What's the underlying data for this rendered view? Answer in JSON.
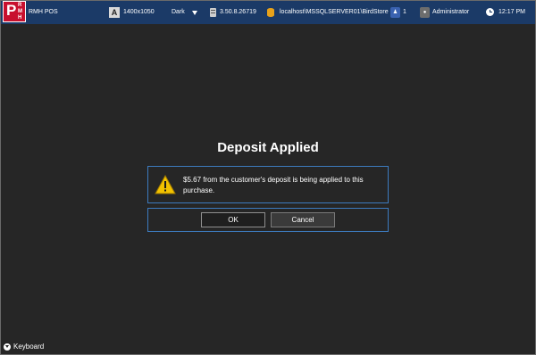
{
  "topbar": {
    "logo": {
      "big_letter": "P",
      "small_letters": [
        "R",
        "M",
        "H"
      ]
    },
    "app_name": "RMH POS",
    "resolution": "1400x1050",
    "resolution_icon_letter": "A",
    "theme": "Dark",
    "version": "3.50.8.26719",
    "database": "localhost\\MSSQLSERVER01\\BirdStore",
    "station": "1",
    "user": "Administrator",
    "time": "12:17 PM"
  },
  "dialog": {
    "title": "Deposit Applied",
    "message": "$5.67 from the customer's deposit is being applied to this purchase.",
    "ok_label": "OK",
    "cancel_label": "Cancel"
  },
  "footer": {
    "keyboard_label": "Keyboard"
  },
  "colors": {
    "topbar_bg": "#1b3a67",
    "background": "#262626",
    "logo_red": "#c8102e",
    "dialog_border": "#3d7bbf",
    "warning_yellow": "#f2c200"
  }
}
